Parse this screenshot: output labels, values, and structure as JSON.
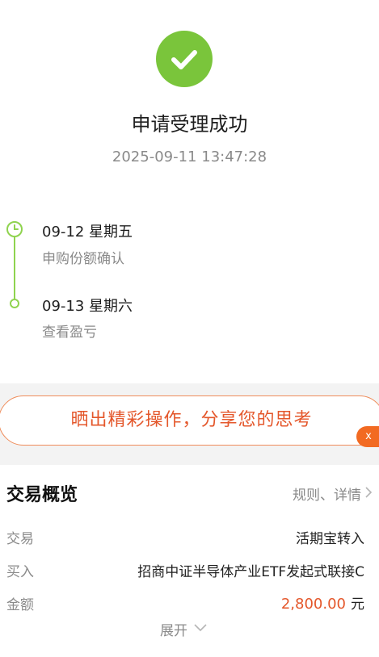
{
  "result": {
    "title": "申请受理成功",
    "time": "2025-09-11 13:47:28"
  },
  "timeline": [
    {
      "date": "09-12  星期五",
      "desc": "申购份额确认"
    },
    {
      "date": "09-13  星期六",
      "desc": "查看盈亏"
    }
  ],
  "share": {
    "text": "晒出精彩操作，分享您的思考",
    "close": "x"
  },
  "overview": {
    "title": "交易概览",
    "rules_link": "规则、详情",
    "rows": [
      {
        "label": "交易",
        "value": "活期宝转入"
      },
      {
        "label": "买入",
        "value": "招商中证半导体产业ETF发起式联接C"
      },
      {
        "label": "金额",
        "amount": "2,800.00",
        "unit": "元"
      }
    ],
    "expand": "展开"
  },
  "colors": {
    "success": "#7ac53b",
    "accent": "#e4572b",
    "muted": "#8a8a8a",
    "timeline": "#8fd34f"
  }
}
